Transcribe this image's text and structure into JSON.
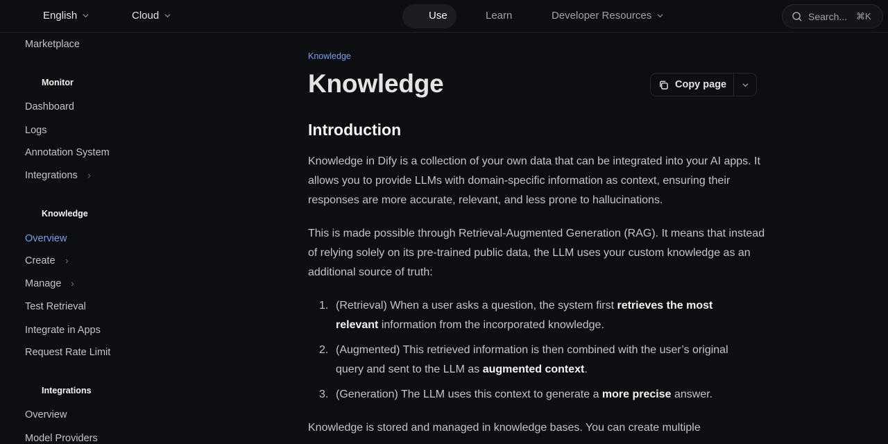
{
  "header": {
    "language": "English",
    "edition": "Cloud",
    "tabs": [
      "Use",
      "Learn",
      "Developer Resources"
    ],
    "search_placeholder": "Search...",
    "search_shortcut": "⌘K"
  },
  "sidebar": {
    "top_item": "Marketplace",
    "groups": [
      {
        "title": "Monitor",
        "items": [
          "Dashboard",
          "Logs",
          "Annotation System",
          "Integrations"
        ]
      },
      {
        "title": "Knowledge",
        "items": [
          "Overview",
          "Create",
          "Manage",
          "Test Retrieval",
          "Integrate in Apps",
          "Request Rate Limit"
        ]
      },
      {
        "title": "Integrations",
        "items": [
          "Overview",
          "Model Providers"
        ]
      }
    ],
    "active_item": "Overview"
  },
  "main": {
    "breadcrumb": "Knowledge",
    "title": "Knowledge",
    "copy_page_label": "Copy page",
    "section_heading": "Introduction",
    "para1": "Knowledge in Dify is a collection of your own data that can be integrated into your AI apps. It allows you to provide LLMs with domain-specific information as context, ensuring their responses are more accurate, relevant, and less prone to hallucinations.",
    "para2": "This is made possible through Retrieval-Augmented Generation (RAG). It means that instead of relying solely on its pre-trained public data, the LLM uses your custom knowledge as an additional source of truth:",
    "list": [
      {
        "num": "1.",
        "before": "(Retrieval) When a user asks a question, the system first ",
        "bold": "retrieves the most relevant",
        "after": " information from the incorporated knowledge."
      },
      {
        "num": "2.",
        "before": "(Augmented) This retrieved information is then combined with the user’s original query and sent to the LLM as ",
        "bold": "augmented context",
        "after": "."
      },
      {
        "num": "3.",
        "before": "(Generation) The LLM uses this context to generate a ",
        "bold": "more precise",
        "after": " answer."
      }
    ],
    "para3": "Knowledge is stored and managed in knowledge bases. You can create multiple"
  },
  "colors": {
    "background": "#0d0e11",
    "accent": "#7c9cf0",
    "text": "#c4c4c9"
  }
}
